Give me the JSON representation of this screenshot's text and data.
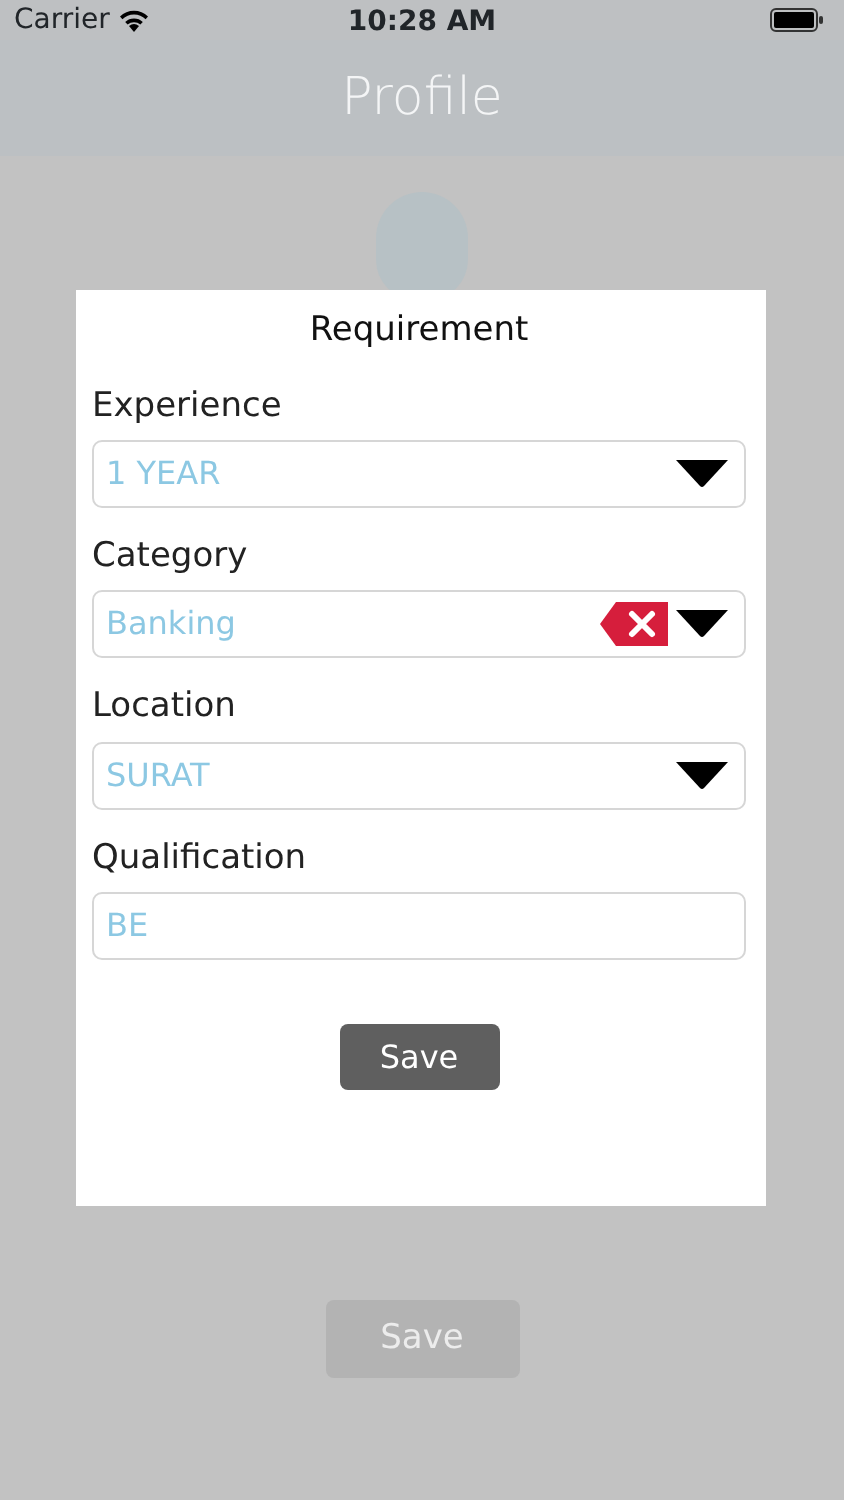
{
  "status_bar": {
    "carrier": "Carrier",
    "time": "10:28 AM"
  },
  "nav": {
    "title": "Profile"
  },
  "background": {
    "save_button": "Save"
  },
  "dialog": {
    "title": "Requirement",
    "fields": [
      {
        "label": "Experience",
        "value": "1 YEAR",
        "kind": "dropdown",
        "clearable": false
      },
      {
        "label": "Category",
        "value": "Banking",
        "kind": "dropdown",
        "clearable": true
      },
      {
        "label": "Location",
        "value": "SURAT",
        "kind": "dropdown",
        "clearable": false
      },
      {
        "label": "Qualification",
        "value": "BE",
        "kind": "text",
        "clearable": false
      }
    ],
    "save_button": "Save"
  }
}
